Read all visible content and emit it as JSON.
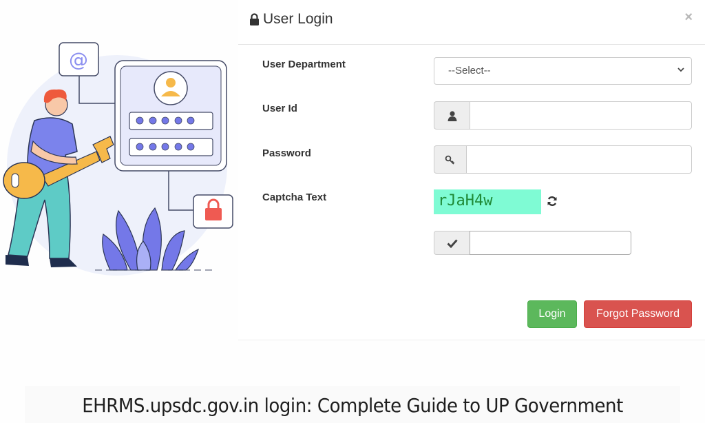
{
  "modal": {
    "title": "User Login",
    "title_icon": "lock-icon",
    "close_label": "×",
    "fields": {
      "department": {
        "label": "User Department",
        "selected": "--Select--"
      },
      "user_id": {
        "label": "User Id",
        "icon": "user-icon",
        "value": ""
      },
      "password": {
        "label": "Password",
        "icon": "key-icon",
        "value": ""
      },
      "captcha": {
        "label": "Captcha Text",
        "code": "rJaH4w",
        "refresh_icon": "refresh-icon",
        "input_icon": "check-icon",
        "value": ""
      }
    },
    "buttons": {
      "login": "Login",
      "forgot": "Forgot Password"
    },
    "colors": {
      "login": "#5cb85c",
      "forgot": "#d9534f",
      "captcha_bg": "#7ffbd4",
      "captcha_text": "#1f8a36"
    }
  },
  "illustration": {
    "description": "person holding key beside login card",
    "icons": [
      "at-sign-icon",
      "user-avatar-icon",
      "padlock-icon",
      "key-icon",
      "plant-icon"
    ]
  },
  "caption": "EHRMS.upsdc.gov.in login: Complete Guide to UP Government"
}
